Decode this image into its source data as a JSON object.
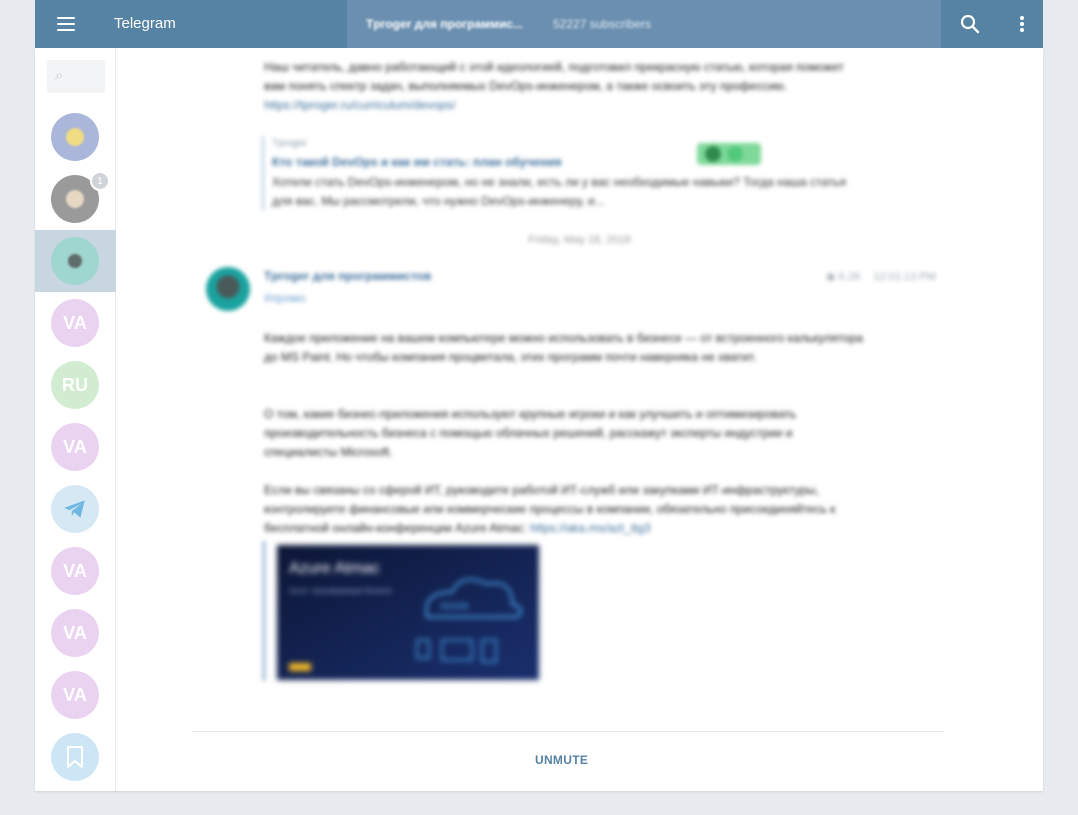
{
  "header": {
    "app_title": "Telegram",
    "chat_title": "Tproger для программис...",
    "chat_subscribers": "52227 subscribers",
    "menu_icon": "hamburger-menu-icon",
    "search_icon": "search-icon",
    "more_icon": "more-vert-icon"
  },
  "sidebar": {
    "search_icon": "search-icon",
    "chats": [
      {
        "initials": "",
        "color": "#aab6da",
        "inner": "#f0dc82",
        "badge": ""
      },
      {
        "initials": "",
        "color": "#9a9a9a",
        "inner": "#e7d8c4",
        "badge": "1"
      },
      {
        "initials": "",
        "color": "#9fd6cf",
        "inner": "#5f6c6c",
        "badge": "",
        "active": true
      },
      {
        "initials": "VA",
        "color": "#e9d3f0",
        "badge": ""
      },
      {
        "initials": "RU",
        "color": "#d2ecd2",
        "badge": ""
      },
      {
        "initials": "VA",
        "color": "#e9d3f0",
        "badge": ""
      },
      {
        "initials": "",
        "color": "#d6e8f4",
        "icon": "telegram-plane-icon",
        "badge": ""
      },
      {
        "initials": "VA",
        "color": "#e9d3f0",
        "badge": ""
      },
      {
        "initials": "VA",
        "color": "#e9d3f0",
        "badge": ""
      },
      {
        "initials": "VA",
        "color": "#e9d3f0",
        "badge": ""
      },
      {
        "initials": "",
        "color": "#cde6f6",
        "icon": "bookmark-icon",
        "badge": ""
      }
    ]
  },
  "messages": {
    "prev_text": "Наш читатель, давно работающий с этой идеологией, подготовил прекрасную статью, которая поможет вам понять спектр задач, выполняемых DevOps-инженером, а также освоить эту профессию.",
    "prev_link": "https://tproger.ru/curriculum/devops/",
    "quote_site": "Tproger",
    "quote_title": "Кто такой DevOps и как им стать: план обучения",
    "quote_desc": "Хотели стать DevOps-инженером, но не знали, есть ли у вас необходимые навыки? Тогда наша статья для вас. Мы рассмотрели, что нужно DevOps-инженеру, и...",
    "date": "Friday, May 18, 2018",
    "author": "Tproger для программистов",
    "tag": "#промо",
    "views": "6.2K",
    "time": "12:01:13 PM",
    "para1": "Каждое приложение на вашем компьютере можно использовать в бизнесе — от встроенного калькулятора до MS Paint. Но чтобы компания процветала, этих программ почти наверняка не хватит.",
    "para2": "О том, какие бизнес-приложения используют крупные игроки и как улучшить и оптимизировать производительность бизнеса с помощью облачных решений, расскажут эксперты индустрии и специалисты Microsoft.",
    "para3": "Если вы связаны со сферой ИТ, руководите работой ИТ-служб или закупками ИТ-инфраструктуры, контролируете финансовые или коммерческие процессы в компании, обязательно присоединяйтесь к бесплатной онлайн-конференции Azure Atmac:",
    "para3_link": "https://aka.ms/azt_ttg3",
    "image_title": "Azure Atmac",
    "image_sub": "Azure: трансформация бизнеса",
    "image_cloud_label": "Azure"
  },
  "footer": {
    "unmute_label": "UNMUTE"
  }
}
